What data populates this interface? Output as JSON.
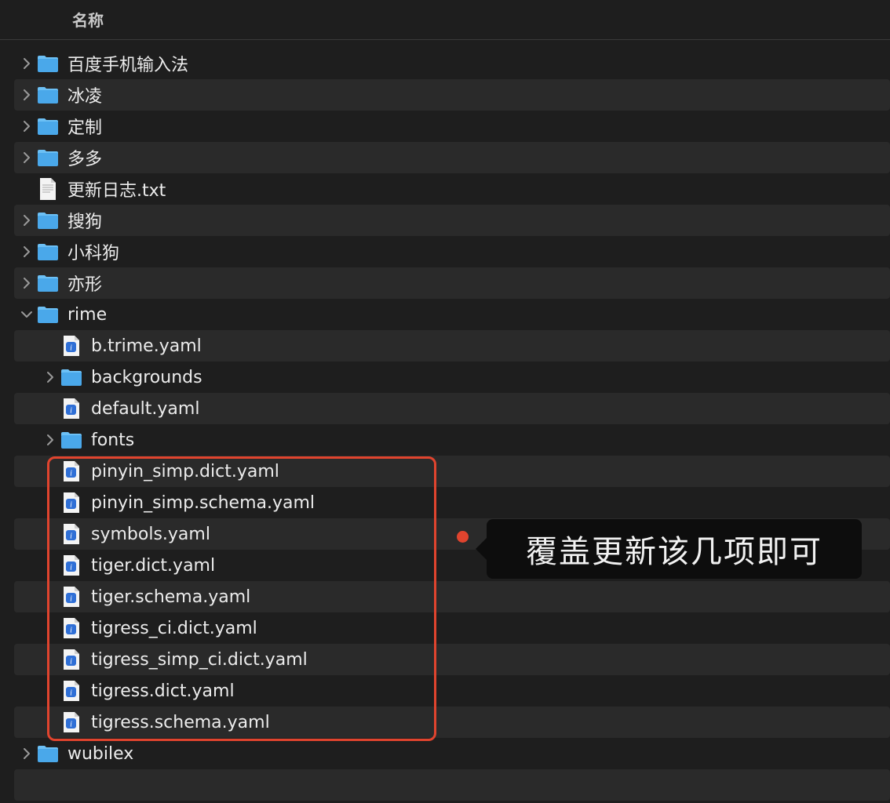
{
  "header": {
    "column_name": "名称"
  },
  "rows": [
    {
      "label": "百度手机输入法",
      "type": "folder",
      "expanded": false,
      "depth": 0
    },
    {
      "label": "冰凌",
      "type": "folder",
      "expanded": false,
      "depth": 0
    },
    {
      "label": "定制",
      "type": "folder",
      "expanded": false,
      "depth": 0
    },
    {
      "label": "多多",
      "type": "folder",
      "expanded": false,
      "depth": 0
    },
    {
      "label": "更新日志.txt",
      "type": "txt",
      "depth": 0
    },
    {
      "label": "搜狗",
      "type": "folder",
      "expanded": false,
      "depth": 0
    },
    {
      "label": "小科狗",
      "type": "folder",
      "expanded": false,
      "depth": 0
    },
    {
      "label": "亦形",
      "type": "folder",
      "expanded": false,
      "depth": 0
    },
    {
      "label": "rime",
      "type": "folder",
      "expanded": true,
      "depth": 0
    },
    {
      "label": "b.trime.yaml",
      "type": "yaml",
      "depth": 1
    },
    {
      "label": "backgrounds",
      "type": "folder",
      "expanded": false,
      "depth": 1
    },
    {
      "label": "default.yaml",
      "type": "yaml",
      "depth": 1
    },
    {
      "label": "fonts",
      "type": "folder",
      "expanded": false,
      "depth": 1
    },
    {
      "label": "pinyin_simp.dict.yaml",
      "type": "yaml",
      "depth": 1
    },
    {
      "label": "pinyin_simp.schema.yaml",
      "type": "yaml",
      "depth": 1
    },
    {
      "label": "symbols.yaml",
      "type": "yaml",
      "depth": 1
    },
    {
      "label": "tiger.dict.yaml",
      "type": "yaml",
      "depth": 1
    },
    {
      "label": "tiger.schema.yaml",
      "type": "yaml",
      "depth": 1
    },
    {
      "label": "tigress_ci.dict.yaml",
      "type": "yaml",
      "depth": 1
    },
    {
      "label": "tigress_simp_ci.dict.yaml",
      "type": "yaml",
      "depth": 1
    },
    {
      "label": "tigress.dict.yaml",
      "type": "yaml",
      "depth": 1
    },
    {
      "label": "tigress.schema.yaml",
      "type": "yaml",
      "depth": 1
    },
    {
      "label": "wubilex",
      "type": "folder",
      "expanded": false,
      "depth": 0
    },
    {
      "label": "",
      "type": "empty",
      "depth": 0
    }
  ],
  "annotation": {
    "text": "覆盖更新该几项即可",
    "color": "#e0442e"
  },
  "colors": {
    "folder": "#4aa8ea",
    "folder_tab": "#6cc0f5",
    "yaml_badge": "#2f6fd6"
  }
}
